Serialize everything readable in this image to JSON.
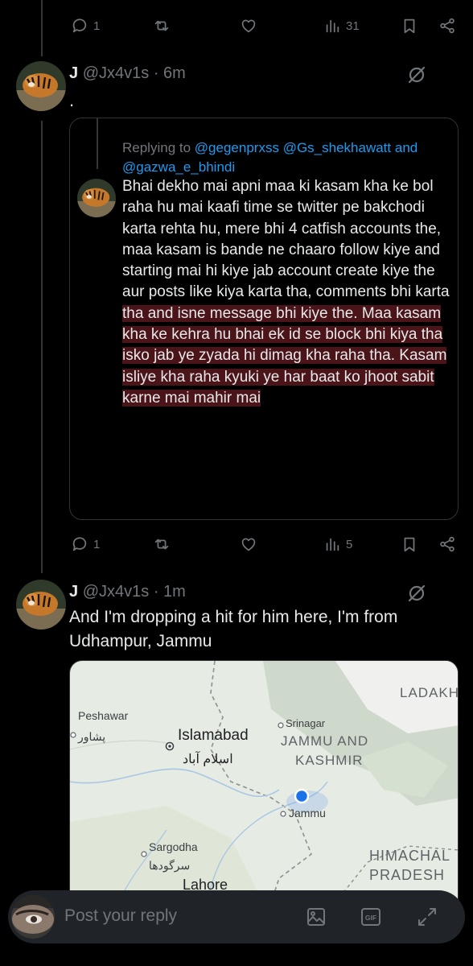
{
  "top_actions": {
    "replies": "1",
    "views": "31"
  },
  "post1": {
    "name": "J",
    "handle": "@Jx4v1s",
    "sep": "·",
    "time": "6m",
    "text": ".",
    "quote": {
      "replying_prefix": "Replying to",
      "mentions": [
        "@gegenprxss",
        "@Gs_shekhawatt",
        "@gazwa_e_bhindi"
      ],
      "and_word": "and",
      "text_plain": "Bhai dekho mai apni maa ki kasam kha ke bol raha hu mai kaafi time se twitter pe bakchodi karta rehta hu, mere bhi 4 catfish accounts the, maa kasam is bande ne chaaro follow kiye and starting mai hi kiye jab account create kiye the aur posts like kiya karta tha, comments bhi karta",
      "text_highlighted": " tha and isne message bhi kiye the. Maa kasam kha ke kehra hu bhai ek id se block bhi kiya tha isko jab ye zyada hi dimag kha raha tha. Kasam isliye kha raha kyuki ye har baat ko jhoot sabit karne mai mahir mai"
    },
    "actions": {
      "replies": "1",
      "views": "5"
    }
  },
  "post2": {
    "name": "J",
    "handle": "@Jx4v1s",
    "sep": "·",
    "time": "1m",
    "text": "And I'm dropping a hit for him here, I'm from Udhampur, Jammu",
    "map_labels": {
      "peshawar": "Peshawar",
      "peshawar_ur": "پشاور",
      "islamabad": "Islamabad",
      "islamabad_ur": "اسلام آباد",
      "srinagar": "Srinagar",
      "jk_line1": "JAMMU AND",
      "jk_line2": "KASHMIR",
      "jammu": "Jammu",
      "ladakh": "LADAKH",
      "sargodha": "Sargodha",
      "sargodha_ur": "سرگودھا",
      "himachal": "HIMACHAL",
      "pradesh": "PRADESH",
      "lahore": "Lahore"
    }
  },
  "composer": {
    "placeholder": "Post your reply"
  },
  "colors": {
    "background": "#000000",
    "text": "#e7e9ea",
    "muted": "#71767b",
    "link": "#1d9bf0",
    "highlight": "#4a1419"
  }
}
